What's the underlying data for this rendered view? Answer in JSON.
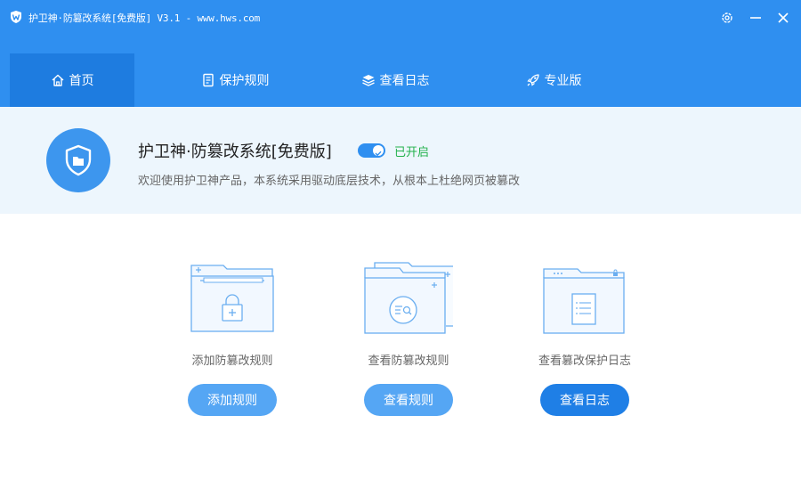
{
  "window": {
    "title": "护卫神·防篡改系统[免费版] V3.1 - www.hws.com",
    "accent": "#2f8ff0"
  },
  "nav": {
    "tabs": [
      {
        "label": "首页",
        "icon": "home-icon",
        "active": true
      },
      {
        "label": "保护规则",
        "icon": "rules-doc-icon",
        "active": false
      },
      {
        "label": "查看日志",
        "icon": "layers-icon",
        "active": false
      },
      {
        "label": "专业版",
        "icon": "rocket-icon",
        "active": false
      }
    ]
  },
  "hero": {
    "product_name": "护卫神·防篡改系统[免费版]",
    "status": "已开启",
    "status_color": "#22b14c",
    "protection_enabled": true,
    "description": "欢迎使用护卫神产品，本系统采用驱动底层技术，从根本上杜绝网页被篡改"
  },
  "cards": [
    {
      "label": "添加防篡改规则",
      "button": "添加规则",
      "illustration": "folder-lock-illustration"
    },
    {
      "label": "查看防篡改规则",
      "button": "查看规则",
      "illustration": "folder-search-illustration"
    },
    {
      "label": "查看篡改保护日志",
      "button": "查看日志",
      "illustration": "log-window-illustration"
    }
  ]
}
